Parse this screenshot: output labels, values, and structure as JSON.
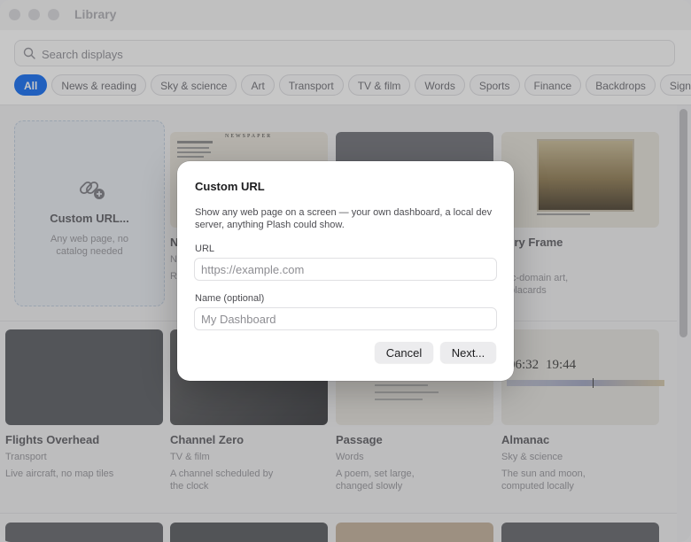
{
  "window": {
    "title": "Library"
  },
  "search": {
    "placeholder": "Search displays"
  },
  "filters": [
    "All",
    "News & reading",
    "Sky & science",
    "Art",
    "Transport",
    "TV & film",
    "Words",
    "Sports",
    "Finance",
    "Backdrops",
    "Sign"
  ],
  "custom_card": {
    "title": "Custom URL...",
    "subtitle": "Any web page, no catalog needed"
  },
  "cards_row1": [
    {
      "title": "N",
      "category": "N",
      "desc": "R"
    },
    {
      "title": "",
      "category": "",
      "desc": ""
    },
    {
      "title": "llery Frame",
      "category": "",
      "desc": "blic-domain art,\nh placards"
    }
  ],
  "cards_row2": [
    {
      "title": "Flights Overhead",
      "category": "Transport",
      "desc": "Live aircraft, no map tiles"
    },
    {
      "title": "Channel Zero",
      "category": "TV & film",
      "desc": "A channel scheduled by\nthe clock"
    },
    {
      "title": "Passage",
      "category": "Words",
      "desc": "A poem, set large,\nchanged slowly"
    },
    {
      "title": "Almanac",
      "category": "Sky & science",
      "desc": "The sun and moon,\ncomputed locally"
    }
  ],
  "thumb_text": {
    "newspaper": "NEWSPAPER",
    "almanac_time1": "06:32",
    "almanac_time2": "19:44"
  },
  "dialog": {
    "title": "Custom URL",
    "description": "Show any web page on a screen — your own dashboard, a local dev server, anything Plash could show.",
    "url_label": "URL",
    "url_placeholder": "https://example.com",
    "name_label": "Name (optional)",
    "name_placeholder": "My Dashboard",
    "cancel": "Cancel",
    "next": "Next..."
  },
  "colors": {
    "accent": "#2b7cf4"
  }
}
